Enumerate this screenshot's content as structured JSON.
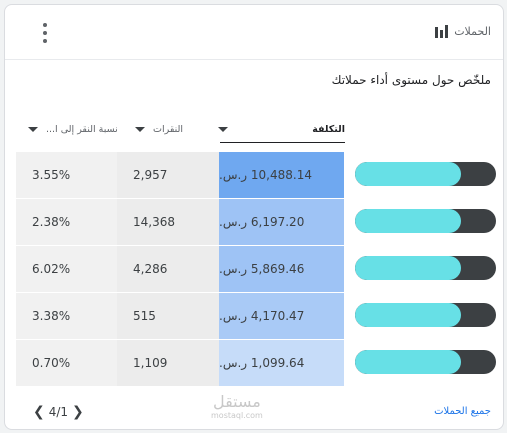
{
  "card": {
    "title": "الحملات",
    "subtitle": "ملخّص حول مستوى أداء حملاتك",
    "menu_icon": "more-vert-icon",
    "title_icon": "bar-chart-icon"
  },
  "columns": {
    "cost": "التكلفة",
    "clicks": "النقرات",
    "rate": "نسبة النقر إلى ا..."
  },
  "rows": [
    {
      "rate": "3.55%",
      "clicks": "2,957",
      "cost": "10,488.14 ر.س.",
      "cost_color": "#6fa8f0",
      "fill": 0.75
    },
    {
      "rate": "2.38%",
      "clicks": "14,368",
      "cost": "6,197.20 ر.س.",
      "cost_color": "#9ec3f5",
      "fill": 0.75
    },
    {
      "rate": "6.02%",
      "clicks": "4,286",
      "cost": "5,869.46 ر.س.",
      "cost_color": "#9ec3f5",
      "fill": 0.75
    },
    {
      "rate": "3.38%",
      "clicks": "515",
      "cost": "4,170.47 ر.س.",
      "cost_color": "#a9caf6",
      "fill": 0.75
    },
    {
      "rate": "0.70%",
      "clicks": "1,109",
      "cost": "1,099.64 ر.س.",
      "cost_color": "#c6dcf9",
      "fill": 0.75
    }
  ],
  "footer": {
    "pager": "4/1",
    "all_campaigns_link": "جميع الحملات",
    "watermark": "مستقل",
    "watermark_sub": "mostaql.com"
  },
  "colors": {
    "bar_fill": "#67e0e6",
    "bar_track": "#3c4043",
    "link": "#1a73e8"
  }
}
